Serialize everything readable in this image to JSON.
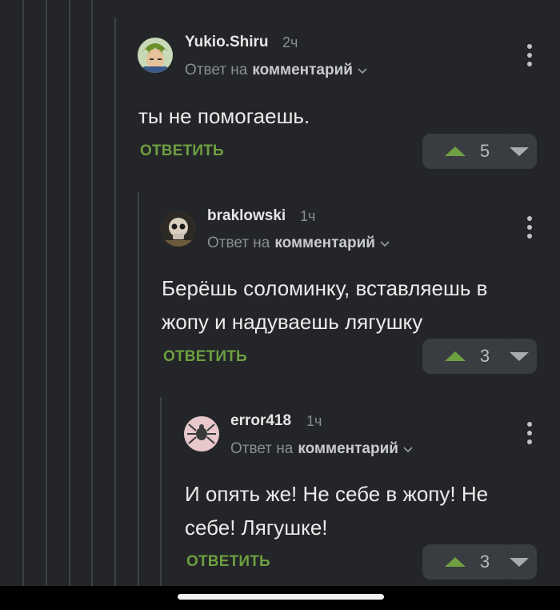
{
  "comments": [
    {
      "username": "Yukio.Shiru",
      "time": "2ч",
      "reply_prefix": "Ответ на",
      "reply_target": "комментарий",
      "text": "ты не помогаешь.",
      "reply_label": "ОТВЕТИТЬ",
      "votes": "5",
      "avatar_icon": "anime-avatar"
    },
    {
      "username": "braklowski",
      "time": "1ч",
      "reply_prefix": "Ответ на",
      "reply_target": "комментарий",
      "text": "Берёшь соломинку, вставляешь в жопу и надуваешь лягушку",
      "reply_label": "ОТВЕТИТЬ",
      "votes": "3",
      "avatar_icon": "skull-avatar"
    },
    {
      "username": "error418",
      "time": "1ч",
      "reply_prefix": "Ответ на",
      "reply_target": "комментарий",
      "text": "И опять же! Не себе в жопу! Не себе! Лягушке!",
      "reply_label": "ОТВЕТИТЬ",
      "votes": "3",
      "avatar_icon": "spider-avatar"
    }
  ],
  "colors": {
    "background": "#232528",
    "accent_green": "#6e9f41",
    "button_bg": "#393c40"
  }
}
